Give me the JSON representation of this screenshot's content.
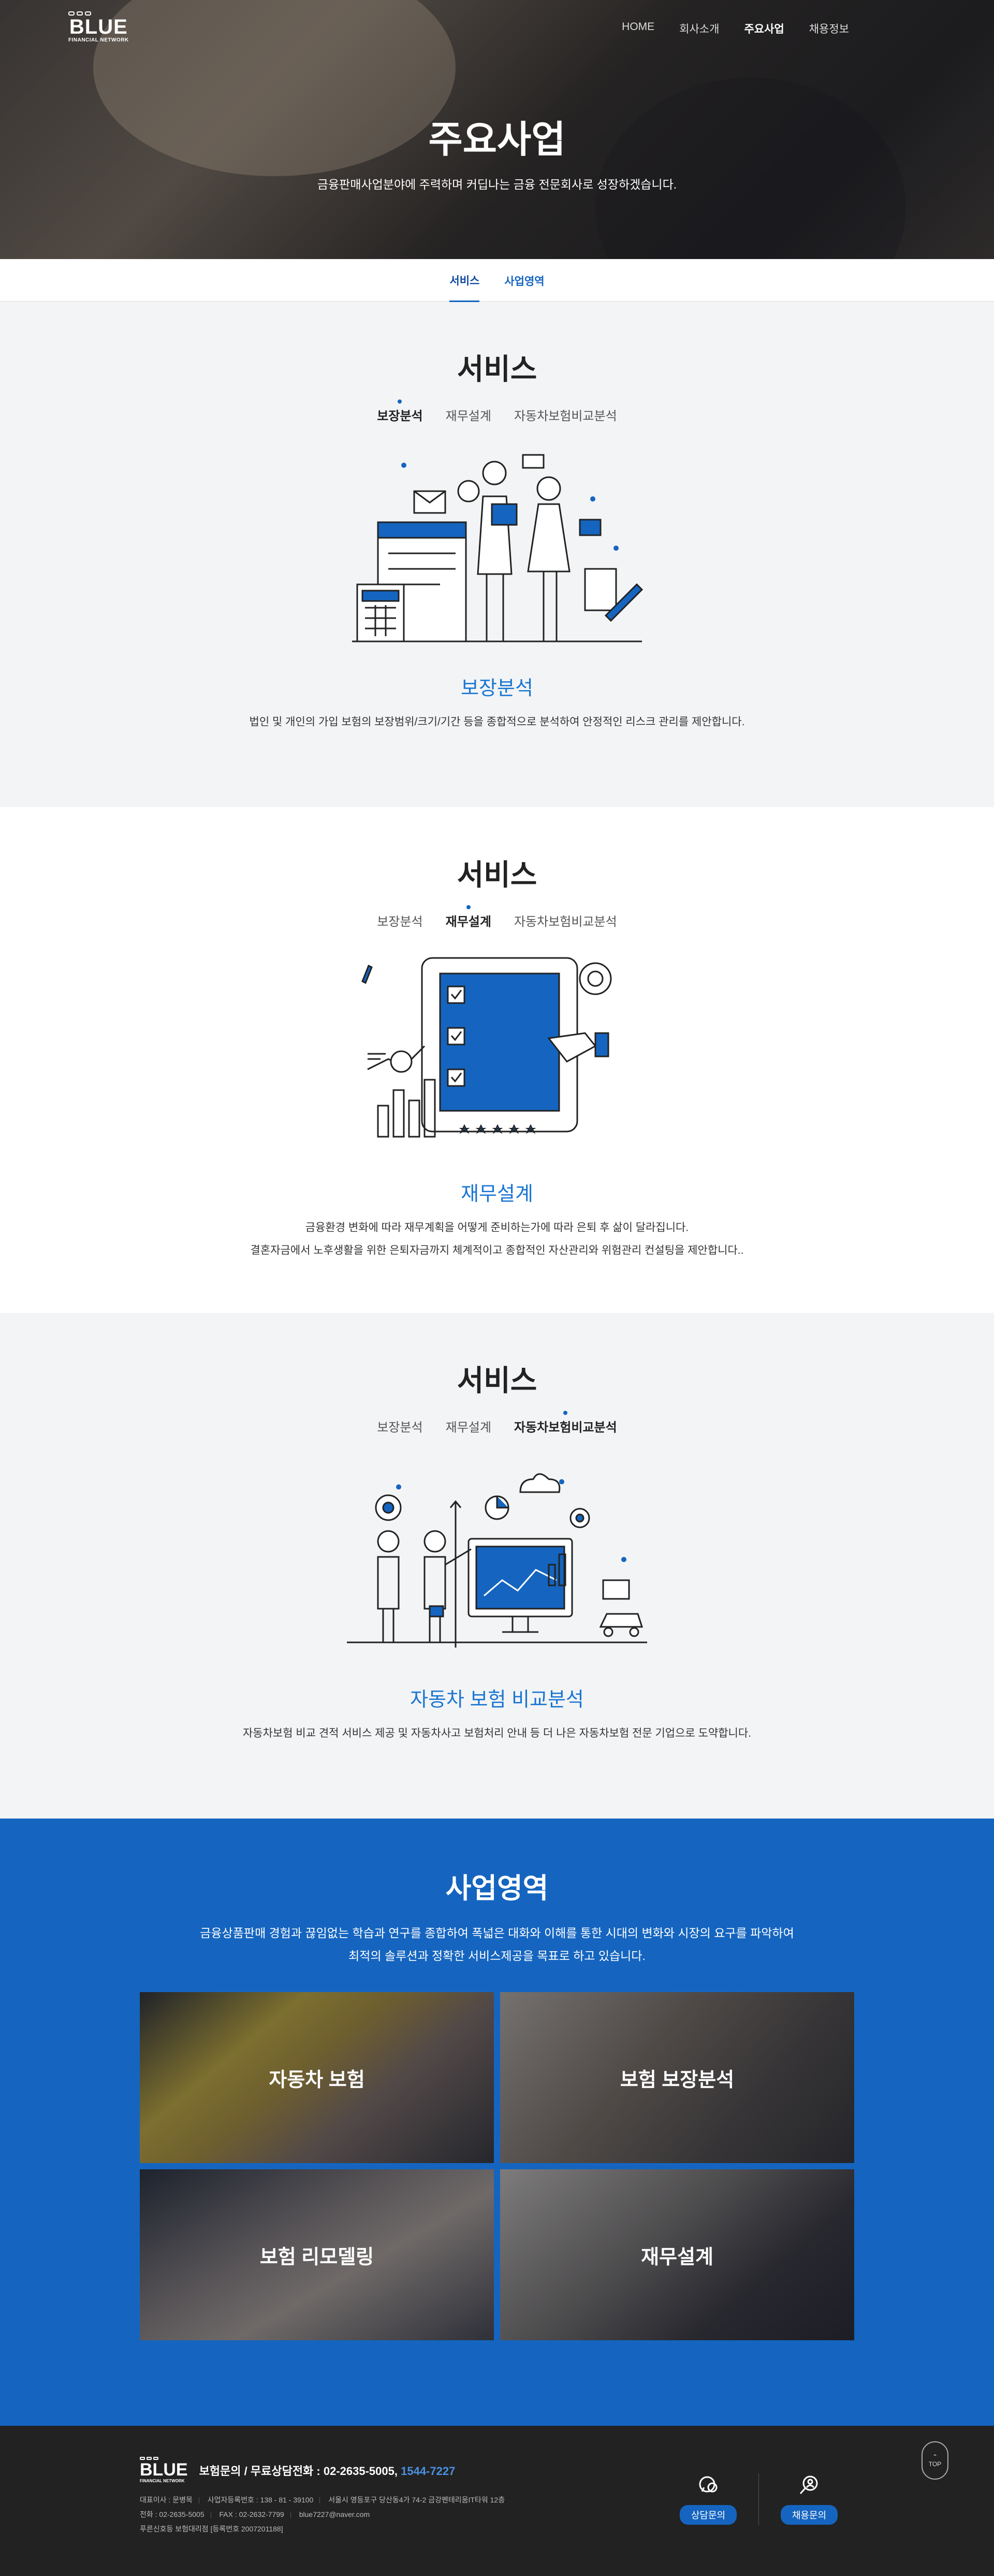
{
  "header": {
    "logo_word": "BLUE",
    "logo_sub": "FINANCIAL NETWORK",
    "menu": [
      "HOME",
      "회사소개",
      "주요사업",
      "채용정보"
    ]
  },
  "hero": {
    "title": "주요사업",
    "subtitle": "금융판매사업분야에 주력하며 커딥나는 금융 전문회사로 성장하겠습니다."
  },
  "tabs": [
    "서비스",
    "사업영역"
  ],
  "services": {
    "section_title": "서비스",
    "sub_tabs": [
      "보장분석",
      "재무설계",
      "자동차보험비교분석"
    ],
    "items": [
      {
        "title": "보장분석",
        "desc1": "법인 및 개인의 가입 보험의 보장범위/크기/기간 등을 종합적으로 분석하여 안정적인 리스크 관리를 제안합니다.",
        "desc2": ""
      },
      {
        "title": "재무설계",
        "desc1": "금융환경 변화에 따라 재무계획을 어떻게 준비하는가에 따라 은퇴 후 삶이 달라집니다.",
        "desc2": "결혼자금에서 노후생활을 위한 은퇴자금까지 체계적이고 종합적인 자산관리와 위험관리 컨설팅을 제안합니다.."
      },
      {
        "title": "자동차 보험 비교분석",
        "desc1": "자동차보험 비교 견적 서비스 제공 및 자동차사고 보험처리 안내 등 더 나은 자동차보험 전문 기업으로 도약합니다.",
        "desc2": ""
      }
    ]
  },
  "business": {
    "title": "사업영역",
    "desc1": "금융상품판매 경험과 끊임없는 학습과 연구를 종합하여 폭넓은 대화와 이해를 통한 시대의 변화와 시장의 요구를 파악하여",
    "desc2": "최적의 솔루션과 정확한 서비스제공을 목표로 하고 있습니다.",
    "cards": [
      "자동차 보험",
      "보험 보장분석",
      "보험 리모델링",
      "재무설계"
    ]
  },
  "footer": {
    "contact_prefix": "보험문의 / 무료상담전화 : 02-2635-5005,",
    "contact_hl": "1544-7227",
    "ceo": "대표이사 : 문병목",
    "biz_no": "사업자등록번호 : 138 - 81 - 39100",
    "address": "서울시 영등포구 당산동4가 74-2 금강펜테리움IT타워 12층",
    "tel": "전화 : 02-2635-5005",
    "fax": "FAX : 02-2632-7799",
    "email": "blue7227@naver.com",
    "agency": "푸른신호등 보험대리점 [등록번호 2007201188]",
    "btn_consult": "상담문의",
    "btn_recruit": "채용문의",
    "top": "TOP"
  },
  "colors": {
    "primary": "#1565c0",
    "footer": "#222222",
    "section_gray": "#f3f4f6"
  }
}
